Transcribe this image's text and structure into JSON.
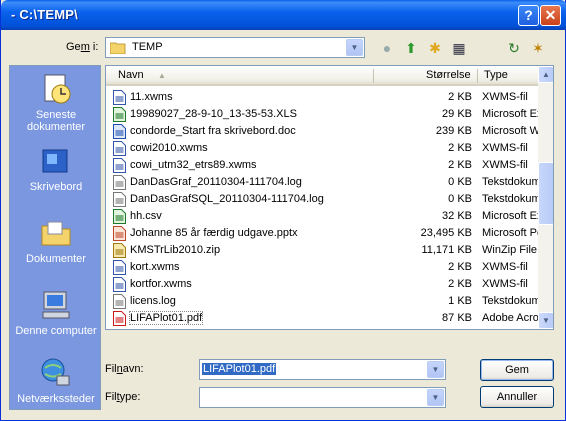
{
  "window": {
    "title": "- C:\\TEMP\\",
    "help_btn": "?",
    "close_btn": "✕"
  },
  "savein": {
    "label": "Gem i:",
    "value": "TEMP"
  },
  "places": [
    {
      "label": "Seneste dokumenter",
      "icon": "recent-documents-icon"
    },
    {
      "label": "Skrivebord",
      "icon": "desktop-icon"
    },
    {
      "label": "Dokumenter",
      "icon": "documents-folder-icon"
    },
    {
      "label": "Denne computer",
      "icon": "computer-icon"
    },
    {
      "label": "Netværkssteder",
      "icon": "network-places-icon"
    }
  ],
  "columns": {
    "name": "Navn",
    "size": "Størrelse",
    "type": "Type"
  },
  "files": [
    {
      "name": "11.xwms",
      "size": "2 KB",
      "type": "XWMS-fil",
      "icon": "xwms-file-icon"
    },
    {
      "name": "19989027_28-9-10_13-35-53.XLS",
      "size": "29 KB",
      "type": "Microsoft Ex",
      "icon": "excel-file-icon"
    },
    {
      "name": "condorde_Start fra skrivebord.doc",
      "size": "239 KB",
      "type": "Microsoft W",
      "icon": "word-file-icon"
    },
    {
      "name": "cowi2010.xwms",
      "size": "2 KB",
      "type": "XWMS-fil",
      "icon": "xwms-file-icon"
    },
    {
      "name": "cowi_utm32_etrs89.xwms",
      "size": "2 KB",
      "type": "XWMS-fil",
      "icon": "xwms-file-icon"
    },
    {
      "name": "DanDasGraf_20110304-111704.log",
      "size": "0 KB",
      "type": "Tekstdokum",
      "icon": "text-file-icon"
    },
    {
      "name": "DanDasGrafSQL_20110304-111704.log",
      "size": "0 KB",
      "type": "Tekstdokum",
      "icon": "text-file-icon"
    },
    {
      "name": "hh.csv",
      "size": "32 KB",
      "type": "Microsoft Ex",
      "icon": "csv-file-icon"
    },
    {
      "name": "Johanne 85 år færdig udgave.pptx",
      "size": "23,495 KB",
      "type": "Microsoft Po",
      "icon": "powerpoint-file-icon"
    },
    {
      "name": "KMSTrLib2010.zip",
      "size": "11,171 KB",
      "type": "WinZip File",
      "icon": "zip-file-icon"
    },
    {
      "name": "kort.xwms",
      "size": "2 KB",
      "type": "XWMS-fil",
      "icon": "xwms-file-icon"
    },
    {
      "name": "kortfor.xwms",
      "size": "2 KB",
      "type": "XWMS-fil",
      "icon": "xwms-file-icon"
    },
    {
      "name": "licens.log",
      "size": "1 KB",
      "type": "Tekstdokum",
      "icon": "text-file-icon"
    },
    {
      "name": "LIFAPlot01.pdf",
      "size": "87 KB",
      "type": "Adobe Acro",
      "icon": "pdf-file-icon"
    }
  ],
  "filename": {
    "label": "Filnavn:",
    "value": "LIFAPlot01.pdf"
  },
  "filetype": {
    "label": "Filtype:",
    "value": ""
  },
  "buttons": {
    "save": "Gem",
    "cancel": "Annuller"
  },
  "colors": {
    "titlebar": "#0a5fe8",
    "places_bg": "#7b97e0",
    "selection": "#316ac5"
  }
}
